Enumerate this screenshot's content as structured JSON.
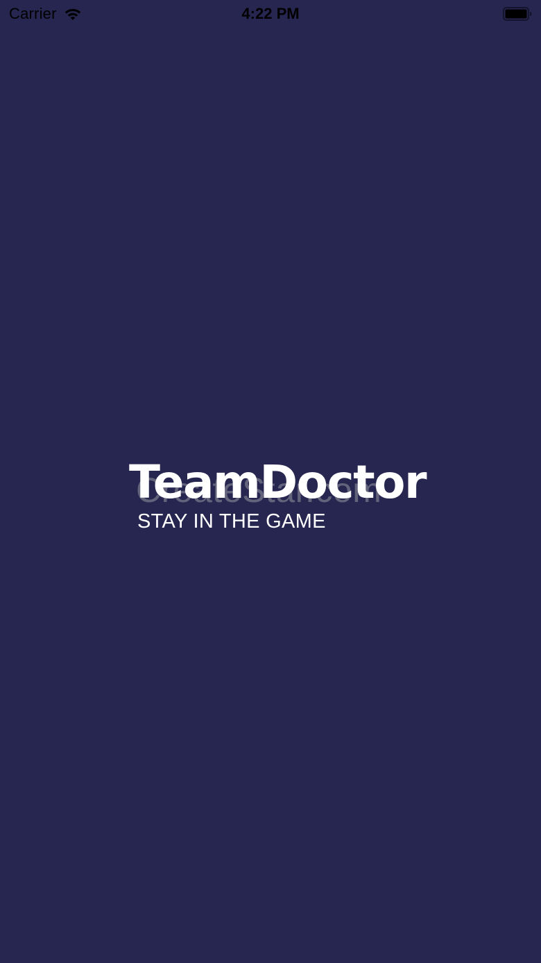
{
  "status_bar": {
    "carrier": "Carrier",
    "time": "4:22 PM",
    "icons": [
      "wifi-icon",
      "battery-icon"
    ]
  },
  "splash": {
    "title": "TeamDoctor",
    "tagline": "STAY IN THE GAME",
    "watermark": "CreateStar.com"
  },
  "colors": {
    "background": "#262650",
    "title": "#ffffff",
    "tagline": "#ffffff",
    "status_text": "#000000"
  }
}
